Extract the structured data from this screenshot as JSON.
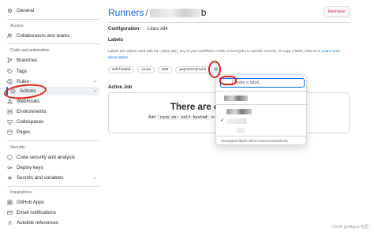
{
  "sidebar": {
    "top_item": {
      "label": "General",
      "icon": "gear-icon"
    },
    "sections": [
      {
        "title": "Access",
        "items": [
          {
            "label": "Collaborators and teams",
            "icon": "people-icon"
          }
        ]
      },
      {
        "title": "Code and automation",
        "items": [
          {
            "label": "Branches",
            "icon": "branch-icon"
          },
          {
            "label": "Tags",
            "icon": "tag-icon"
          },
          {
            "label": "Rules",
            "icon": "rules-icon"
          },
          {
            "label": "Actions",
            "icon": "play-icon"
          },
          {
            "label": "Webhooks",
            "icon": "webhook-icon"
          },
          {
            "label": "Environments",
            "icon": "server-icon"
          },
          {
            "label": "Codespaces",
            "icon": "codespaces-icon"
          },
          {
            "label": "Pages",
            "icon": "browser-icon"
          }
        ]
      },
      {
        "title": "Security",
        "items": [
          {
            "label": "Code security and analysis",
            "icon": "shield-icon"
          },
          {
            "label": "Deploy keys",
            "icon": "key-icon"
          },
          {
            "label": "Secrets and variables",
            "icon": "asterisk-icon"
          }
        ]
      },
      {
        "title": "Integrations",
        "items": [
          {
            "label": "GitHub Apps",
            "icon": "apps-icon"
          },
          {
            "label": "Email notifications",
            "icon": "mail-icon"
          },
          {
            "label": "Autolink references",
            "icon": "link-icon"
          }
        ]
      }
    ]
  },
  "header": {
    "breadcrumb_root": "Runners",
    "breadcrumb_sep": "/",
    "breadcrumb_tail": "b",
    "remove_label": "Remove"
  },
  "configuration": {
    "label": "Configuration:",
    "value": "Linux x64"
  },
  "labels": {
    "title": "Labels",
    "desc_1": "Labels are values used with the",
    "desc_code": "runs-on:",
    "desc_2": "key in your workflow's YAML to send jobs to specific runners. To copy a label, click on it.",
    "desc_link": "Learn more about labels.",
    "chips": [
      "self-hosted",
      "Linux",
      "X64",
      "payment-prod-b"
    ]
  },
  "active_job": {
    "title": "Active Job",
    "heading": "There are curr",
    "sub_1": "Add",
    "sub_code": "`runs-on: self-hosted`",
    "sub_2": "to your"
  },
  "dropdown": {
    "placeholder": "Create a label...",
    "note": "Unassigned labels will be removed periodically"
  },
  "watermark": "CSDN @Allgoal 花园",
  "colors": {
    "accent": "#0969da",
    "danger": "#d1242f",
    "annotation": "#e0201c"
  }
}
